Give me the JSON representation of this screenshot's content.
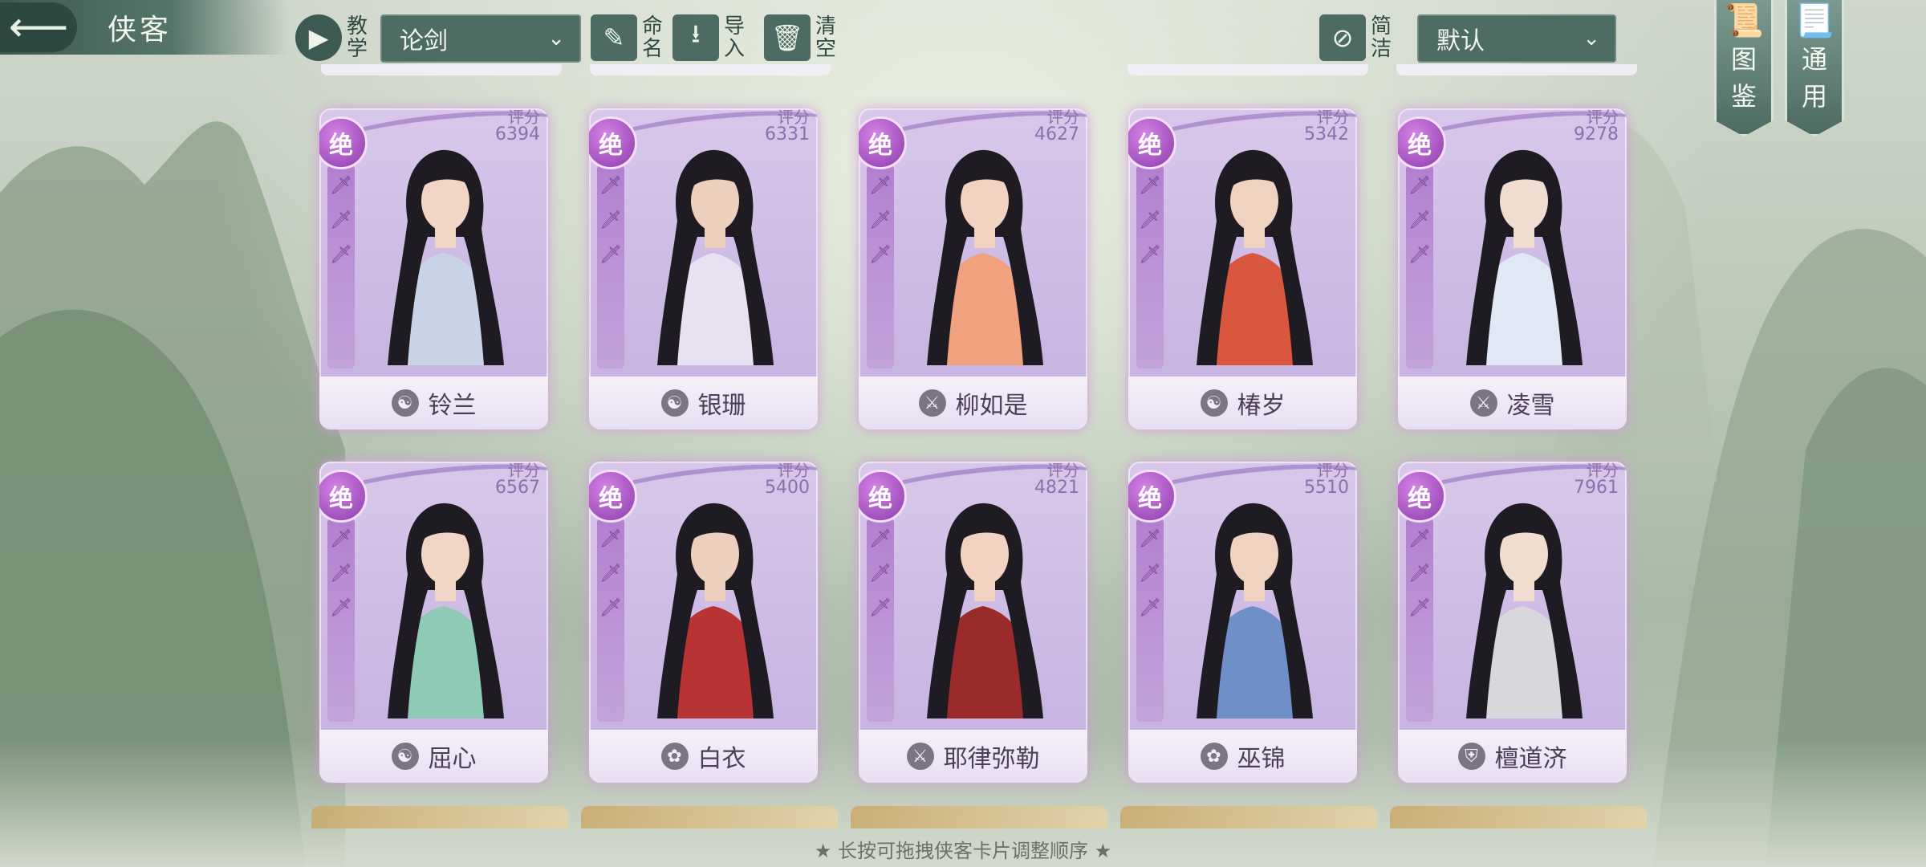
{
  "header": {
    "title": "侠客",
    "tutorial": [
      "教",
      "学"
    ],
    "mode_select": "论剑",
    "rename": [
      "命",
      "名"
    ],
    "import": [
      "导",
      "入"
    ],
    "clear": [
      "清",
      "空"
    ],
    "concise": [
      "简",
      "洁"
    ],
    "sort_select": "默认"
  },
  "side_tabs": [
    {
      "label": [
        "图",
        "鉴"
      ],
      "icon": "book-icon"
    },
    {
      "label": [
        "通",
        "用"
      ],
      "icon": "scroll-icon"
    }
  ],
  "score_label": "评分",
  "rank_label": "绝",
  "cards": [
    {
      "name": "铃兰",
      "score": "6394",
      "faction": "yin-yang"
    },
    {
      "name": "银珊",
      "score": "6331",
      "faction": "yin-yang"
    },
    {
      "name": "柳如是",
      "score": "4627",
      "faction": "sword"
    },
    {
      "name": "椿岁",
      "score": "5342",
      "faction": "yin-yang"
    },
    {
      "name": "凌雪",
      "score": "9278",
      "faction": "sword"
    },
    {
      "name": "屈心",
      "score": "6567",
      "faction": "yin-yang"
    },
    {
      "name": "白衣",
      "score": "5400",
      "faction": "lotus"
    },
    {
      "name": "耶律弥勒",
      "score": "4821",
      "faction": "sword"
    },
    {
      "name": "巫锦",
      "score": "5510",
      "faction": "lotus"
    },
    {
      "name": "檀道济",
      "score": "7961",
      "faction": "shield"
    }
  ],
  "hint": "★ 长按可拖拽侠客卡片调整顺序 ★",
  "colors": {
    "card_bg": "#c9b4e2",
    "badge": "#a553c7",
    "bar": "#4e6c63"
  }
}
